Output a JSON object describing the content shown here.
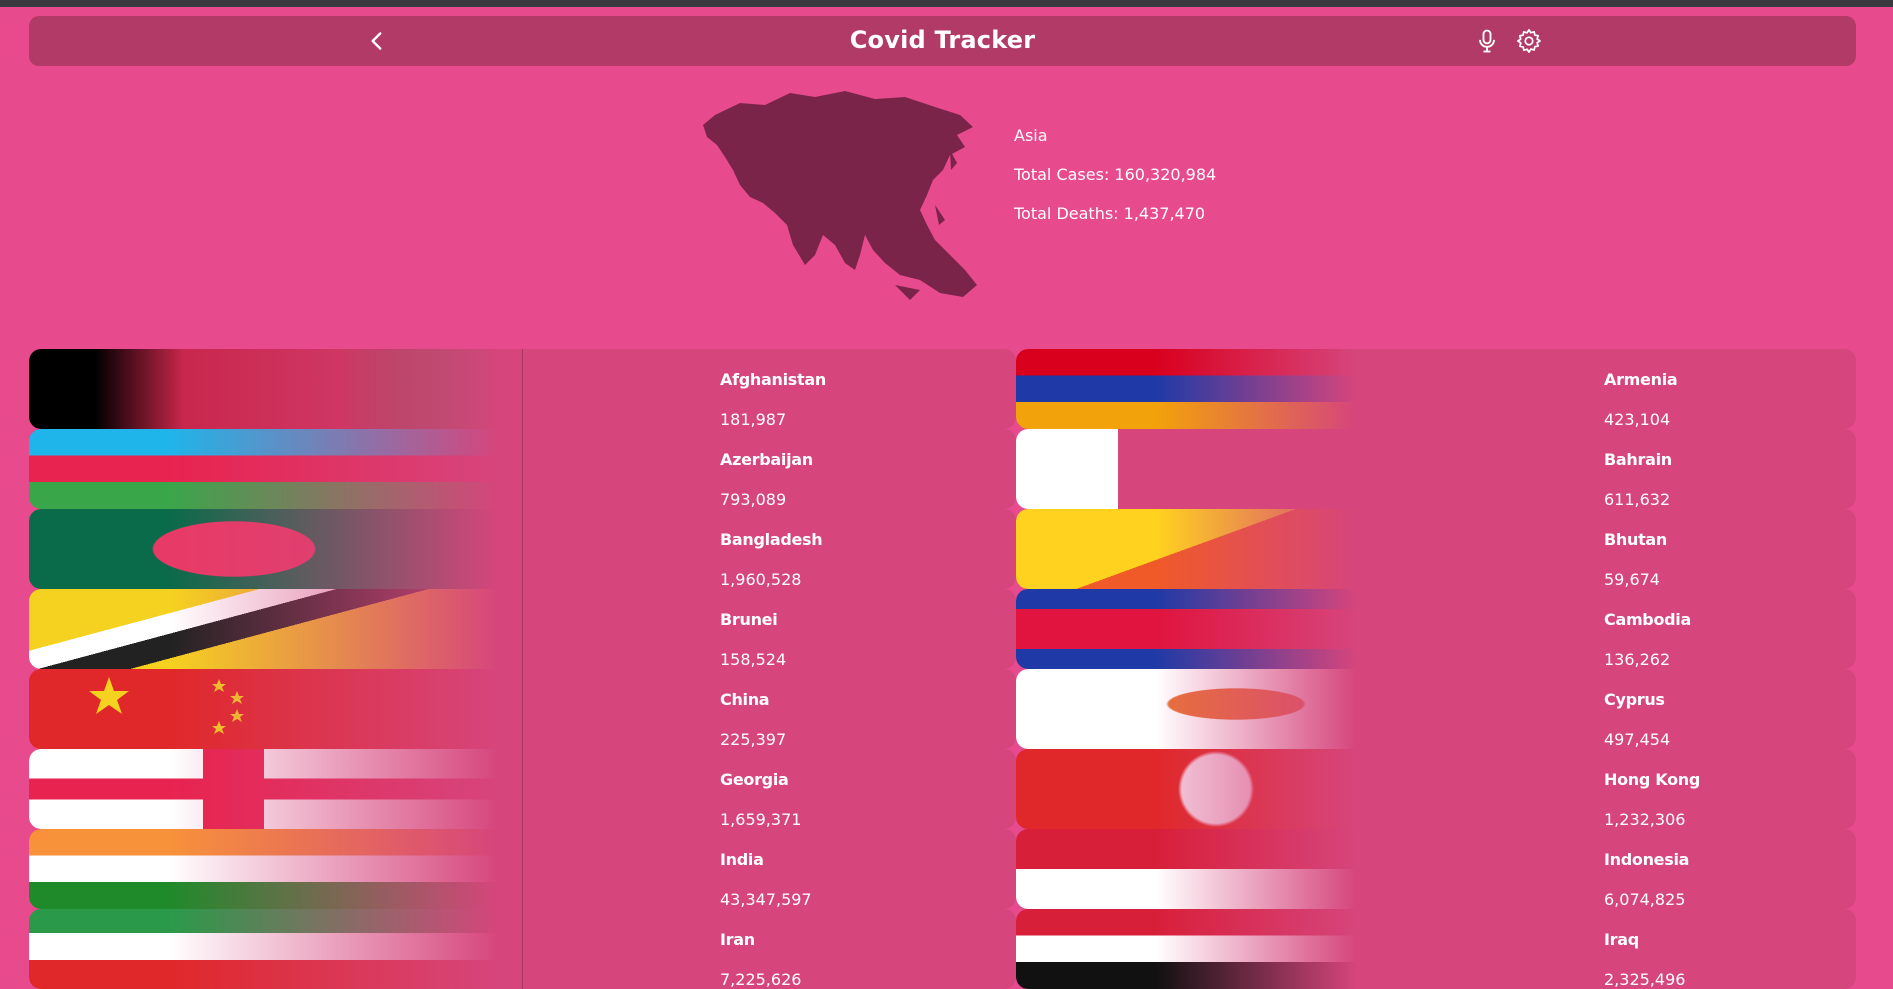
{
  "header": {
    "title": "Covid Tracker"
  },
  "region": {
    "name": "Asia",
    "total_cases": "Total Cases: 160,320,984",
    "total_deaths": "Total Deaths: 1,437,470"
  },
  "countries_left": [
    {
      "name": "Afghanistan",
      "cases": "181,987"
    },
    {
      "name": "Azerbaijan",
      "cases": "793,089"
    },
    {
      "name": "Bangladesh",
      "cases": "1,960,528"
    },
    {
      "name": "Brunei",
      "cases": "158,524"
    },
    {
      "name": "China",
      "cases": "225,397"
    },
    {
      "name": "Georgia",
      "cases": "1,659,371"
    },
    {
      "name": "India",
      "cases": "43,347,597"
    },
    {
      "name": "Iran",
      "cases": "7,225,626"
    }
  ],
  "countries_right": [
    {
      "name": "Armenia",
      "cases": "423,104"
    },
    {
      "name": "Bahrain",
      "cases": "611,632"
    },
    {
      "name": "Bhutan",
      "cases": "59,674"
    },
    {
      "name": "Cambodia",
      "cases": "136,262"
    },
    {
      "name": "Cyprus",
      "cases": "497,454"
    },
    {
      "name": "Hong Kong",
      "cases": "1,232,306"
    },
    {
      "name": "Indonesia",
      "cases": "6,074,825"
    },
    {
      "name": "Iraq",
      "cases": "2,325,496"
    }
  ],
  "colors": {
    "background": "#e84a8e",
    "header": "#b23a66",
    "card": "#d6457c",
    "map": "#7a2449"
  },
  "icons": {
    "back": "chevron-left-icon",
    "mic": "microphone-icon",
    "settings": "gear-icon"
  }
}
